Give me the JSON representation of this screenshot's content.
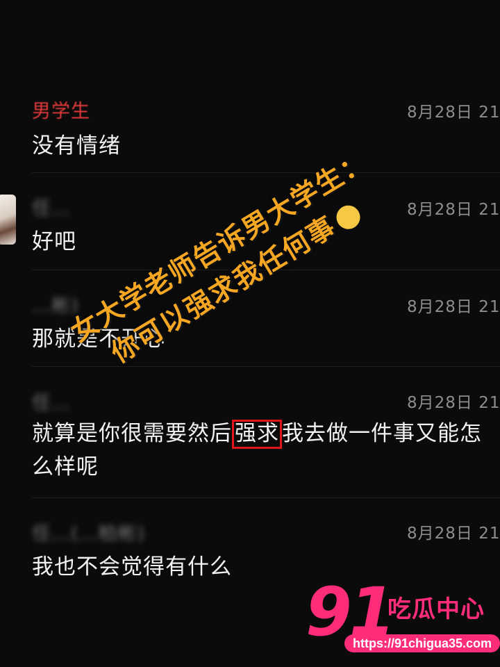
{
  "messages": [
    {
      "sender": "男学生",
      "time": "8月28日 21",
      "text": "没有情绪"
    },
    {
      "sender": "任…",
      "time": "8月28日 21",
      "text": "好吧"
    },
    {
      "sender": "…彬)",
      "time": "8月28日 21",
      "text": "那就是不开心"
    },
    {
      "sender": "任…",
      "time": "8月28日 21",
      "text_before": "就算是你很需要然后",
      "text_highlight": "强求",
      "text_after": "我去做一件事又能怎",
      "text_line2": "么样呢"
    },
    {
      "sender": "任…(…柏彬)",
      "time": "8月28日 21",
      "text": "我也不会觉得有什么"
    }
  ],
  "overlay": {
    "line1": "女大学老师告诉男大学生：",
    "line2": "你可以强求我任何事",
    "emoji": "man-shrugging-emoji",
    "color": "#f5a623"
  },
  "watermark": {
    "number": "91",
    "name": "吃瓜中心",
    "url": "https://91chigua35.com",
    "color": "#ff2c7a"
  },
  "colors": {
    "background": "#0b0b0c",
    "highlight_box": "#e0161b",
    "sender_red": "#e23b3b"
  }
}
